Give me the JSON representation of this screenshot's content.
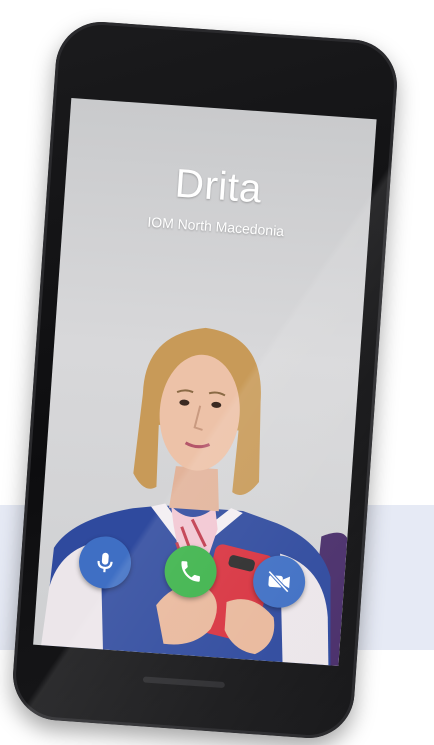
{
  "call": {
    "caller_name": "Drita",
    "caller_subtitle": "IOM North Macedonia"
  },
  "controls": [
    {
      "name": "mute-microphone",
      "icon": "microphone-icon",
      "color": "#3f6fc4"
    },
    {
      "name": "answer-call",
      "icon": "phone-icon",
      "color": "#3cb34a"
    },
    {
      "name": "video-off",
      "icon": "video-camera-off-icon",
      "color": "#3f6fc4"
    }
  ],
  "colors": {
    "accent_blue": "#3f6fc4",
    "answer_green": "#3cb34a",
    "phone_body": "#111113",
    "backdrop_panel": "#e6eaf5"
  }
}
